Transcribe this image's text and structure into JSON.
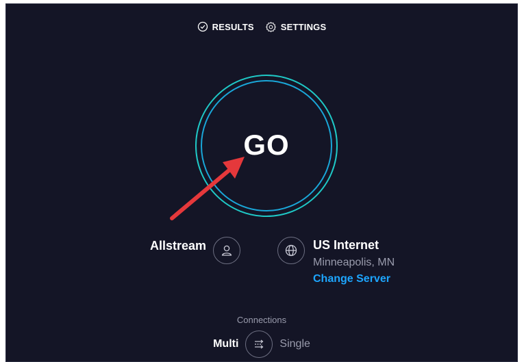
{
  "nav": {
    "results_label": "RESULTS",
    "settings_label": "SETTINGS"
  },
  "go_button": {
    "label": "GO"
  },
  "provider": {
    "name": "Allstream",
    "icon": "user-icon"
  },
  "server": {
    "name": "US Internet",
    "location": "Minneapolis, MN",
    "change_label": "Change Server",
    "icon": "globe-icon"
  },
  "connections": {
    "label": "Connections",
    "multi_label": "Multi",
    "single_label": "Single",
    "icon": "connections-icon"
  },
  "colors": {
    "background": "#141526",
    "ring_outer": "#1fc8c6",
    "ring_inner": "#1aa7d9",
    "link": "#1da6ff",
    "arrow": "#e5383b"
  }
}
